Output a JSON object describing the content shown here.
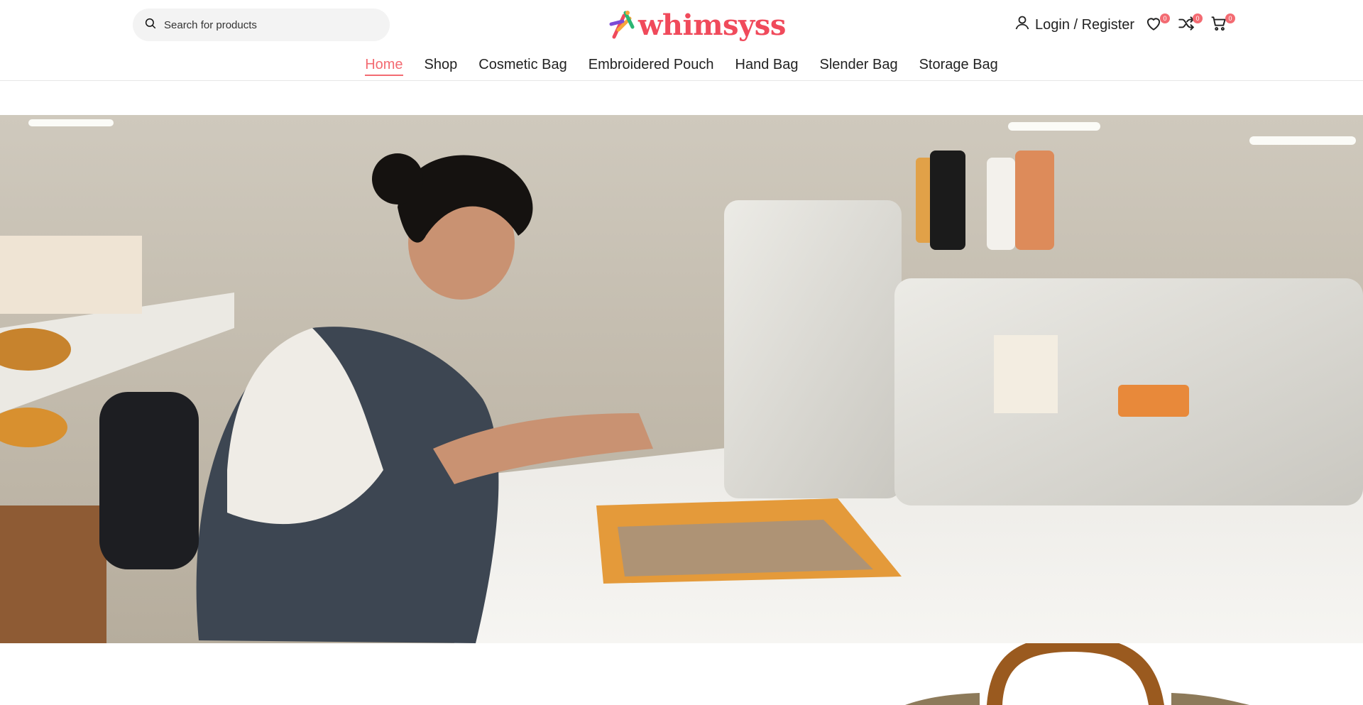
{
  "search": {
    "placeholder": "Search for products"
  },
  "brand": {
    "name": "whimsyss",
    "color": "#f04a5b"
  },
  "account": {
    "label": "Login / Register"
  },
  "header_icons": [
    {
      "name": "wishlist-icon",
      "count": "0"
    },
    {
      "name": "compare-icon",
      "count": "0"
    },
    {
      "name": "cart-icon",
      "count": "0"
    }
  ],
  "nav": {
    "items": [
      {
        "label": "Home",
        "active": true
      },
      {
        "label": "Shop"
      },
      {
        "label": "Cosmetic Bag"
      },
      {
        "label": "Embroidered Pouch"
      },
      {
        "label": "Hand Bag"
      },
      {
        "label": "Slender Bag"
      },
      {
        "label": "Storage Bag"
      }
    ]
  },
  "colors": {
    "accent": "#f36b72",
    "badge": "#f36b72",
    "search_bg": "#f3f3f3"
  },
  "hero": {
    "image_description_icon": "embroidery-workshop-photo"
  }
}
